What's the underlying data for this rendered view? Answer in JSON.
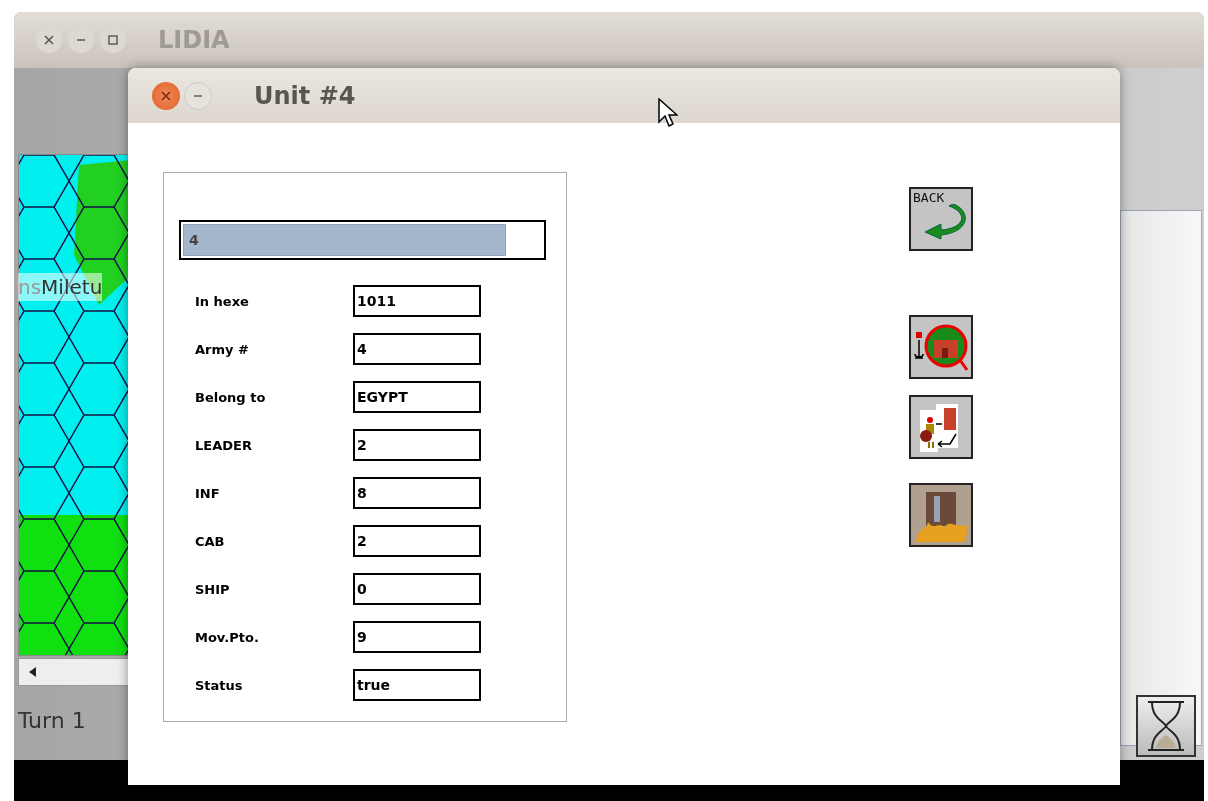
{
  "main_window": {
    "title": "LIDIA",
    "map_labels": [
      {
        "text": "ns",
        "faded": true
      },
      {
        "text": "Miletu",
        "faded": false
      }
    ],
    "turn": "Turn 1"
  },
  "dialog": {
    "title": "Unit #4",
    "progress": {
      "text": "4",
      "level": 0.89
    },
    "fields": [
      {
        "label": "In hexe",
        "value": "1011"
      },
      {
        "label": "Army #",
        "value": "4"
      },
      {
        "label": "Belong to",
        "value": "EGYPT"
      },
      {
        "label": "LEADER",
        "value": "2"
      },
      {
        "label": "INF",
        "value": "8"
      },
      {
        "label": "CAB",
        "value": "2"
      },
      {
        "label": "SHIP",
        "value": "0"
      },
      {
        "label": "Mov.Pto.",
        "value": "9"
      },
      {
        "label": "Status",
        "value": "true"
      }
    ],
    "tools": [
      {
        "kind": "back",
        "text": "BACK"
      },
      {
        "kind": "castle"
      },
      {
        "kind": "exchange"
      },
      {
        "kind": "fire"
      }
    ]
  }
}
